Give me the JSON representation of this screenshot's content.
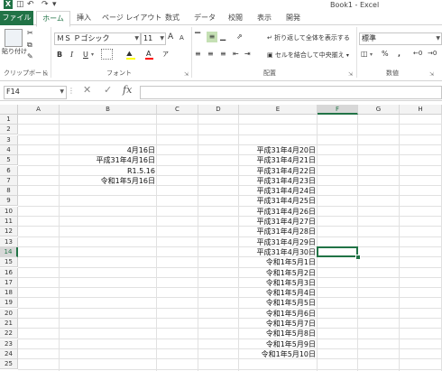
{
  "window": {
    "title": "Book1 - Excel"
  },
  "quick_access": {
    "undo": "↶",
    "redo": "↷"
  },
  "tabs": [
    {
      "label": "ファイル"
    },
    {
      "label": "ホーム"
    },
    {
      "label": "挿入"
    },
    {
      "label": "ページ レイアウト"
    },
    {
      "label": "数式"
    },
    {
      "label": "データ"
    },
    {
      "label": "校閲"
    },
    {
      "label": "表示"
    },
    {
      "label": "開発"
    }
  ],
  "ribbon": {
    "clipboard": {
      "paste_label": "貼り付け",
      "group_label": "クリップボード"
    },
    "font": {
      "font_name": "ＭＳ Ｐゴシック",
      "font_size": "11",
      "grow": "A",
      "shrink": "A",
      "bold": "B",
      "italic": "I",
      "underline": "U",
      "group_label": "フォント"
    },
    "alignment": {
      "wrap_text": "折り返して全体を表示する",
      "merge_center": "セルを結合して中央揃え",
      "group_label": "配置"
    },
    "number": {
      "format": "標準",
      "percent": "%",
      "comma": ",",
      "group_label": "数値"
    }
  },
  "formula_bar": {
    "name_box": "F14",
    "fx": "fx",
    "value": ""
  },
  "grid": {
    "columns": [
      "A",
      "B",
      "C",
      "D",
      "E",
      "F",
      "G",
      "H"
    ],
    "selected_column": "F",
    "rows": [
      "1",
      "2",
      "3",
      "4",
      "5",
      "6",
      "7",
      "8",
      "9",
      "10",
      "11",
      "12",
      "13",
      "14",
      "15",
      "16",
      "17",
      "18",
      "19",
      "20",
      "21",
      "22",
      "23",
      "24",
      "25"
    ],
    "selected_row": "14",
    "column_b": [
      "4月16日",
      "平成31年4月16日",
      "R1.5.16",
      "令和1年5月16日"
    ],
    "column_e": [
      "平成31年4月20日",
      "平成31年4月21日",
      "平成31年4月22日",
      "平成31年4月23日",
      "平成31年4月24日",
      "平成31年4月25日",
      "平成31年4月26日",
      "平成31年4月27日",
      "平成31年4月28日",
      "平成31年4月29日",
      "平成31年4月30日",
      "令和1年5月1日",
      "令和1年5月2日",
      "令和1年5月3日",
      "令和1年5月4日",
      "令和1年5月5日",
      "令和1年5月6日",
      "令和1年5月7日",
      "令和1年5月8日",
      "令和1年5月9日",
      "令和1年5月10日"
    ]
  }
}
